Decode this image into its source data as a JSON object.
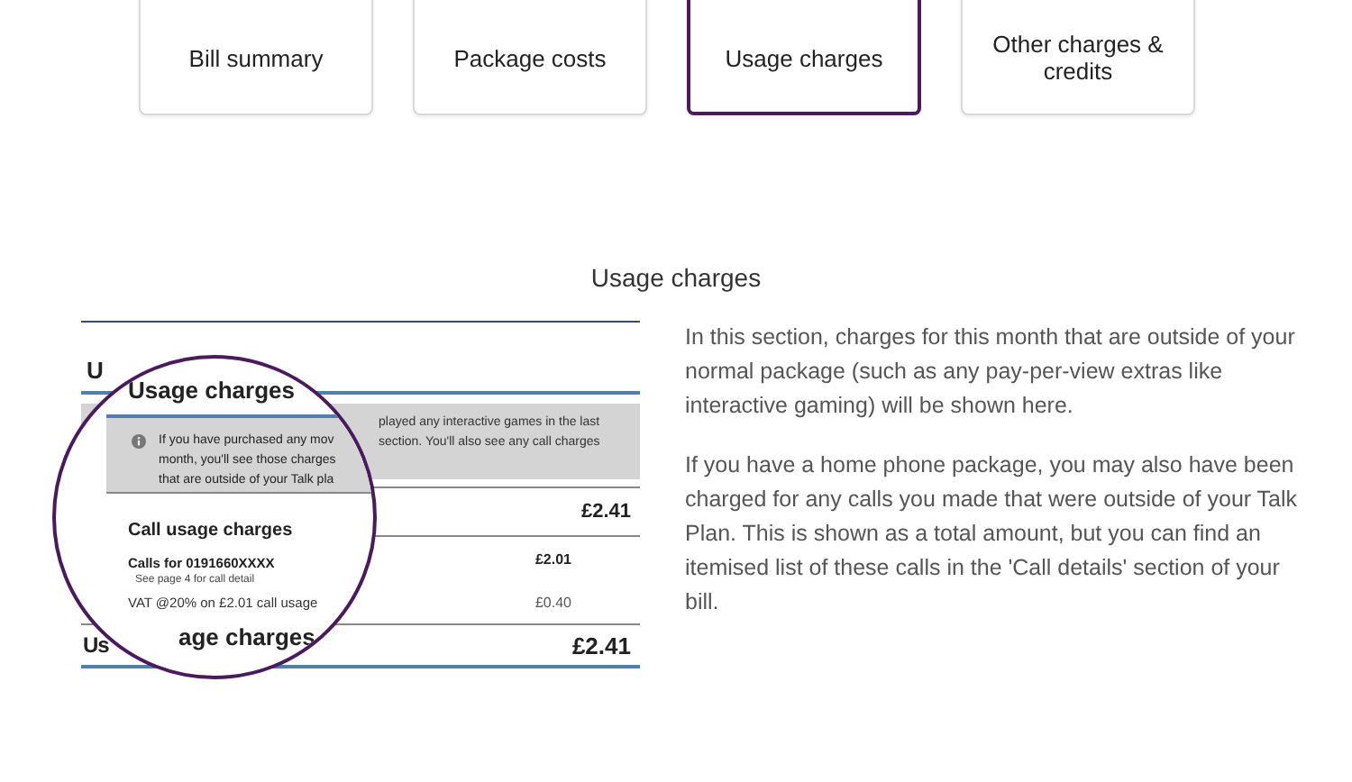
{
  "tabs": [
    {
      "label": "Bill summary",
      "selected": false
    },
    {
      "label": "Package costs",
      "selected": false
    },
    {
      "label": "Usage charges",
      "selected": true
    },
    {
      "label": "Other charges & credits",
      "selected": false
    }
  ],
  "section": {
    "title": "Usage charges",
    "paragraphs": [
      "In this section, charges for this month that are outside of your normal package (such as any pay-per-view extras like interactive gaming) will be shown here.",
      "If you have a home phone package, you may also have been charged for any calls you made that were outside of your Talk Plan. This is shown as a total amount, but you can find an itemised list of these calls in the 'Call details' section of your bill."
    ]
  },
  "bill_image": {
    "background": {
      "heading": "U",
      "notice_lines": [
        "played any interactive games in the last",
        "section. You'll also see any call charges"
      ],
      "subtotal": "£2.41",
      "calls_amount": "£2.01",
      "vat_amount": "£0.40",
      "total_label": "Us",
      "total": "£2.41"
    },
    "magnifier": {
      "heading": "Usage charges",
      "notice_lines": [
        "If you have purchased any mov",
        "month, you'll see those charges",
        "that are outside of your Talk pla"
      ],
      "subheading": "Call usage charges",
      "calls_label": "Calls for 0191660XXXX",
      "calls_note": "See page 4 for call detail",
      "vat_label": "VAT @20% on £2.01  call usage",
      "footer": "age charges"
    }
  }
}
